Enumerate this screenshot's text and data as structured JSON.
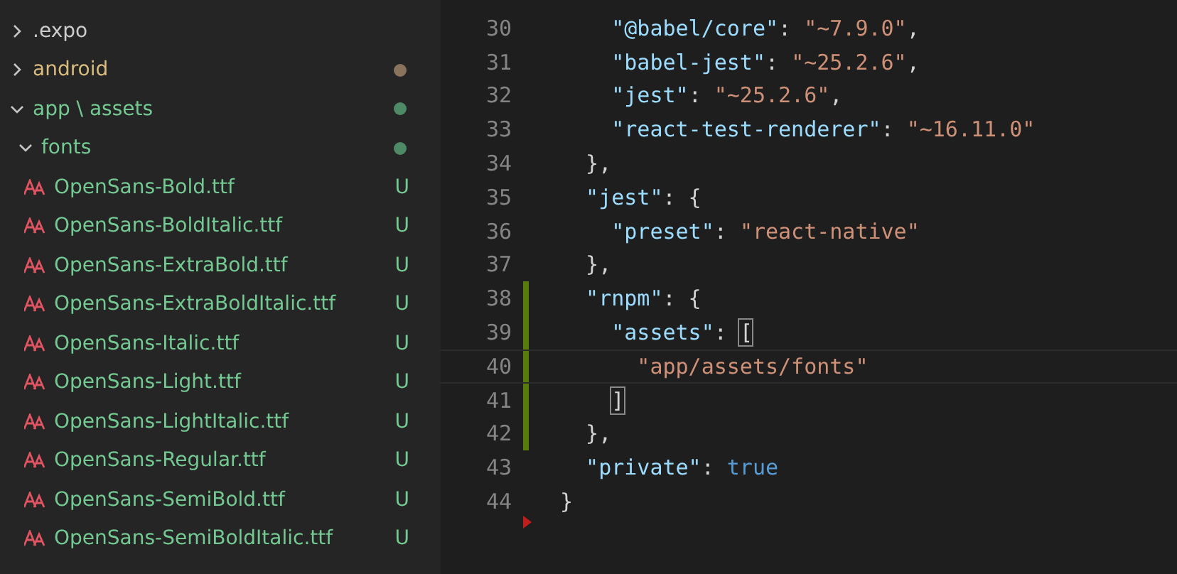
{
  "explorer": {
    "items": [
      {
        "label": ".expo",
        "kind": "folder",
        "expanded": false,
        "color": "#cccccc"
      },
      {
        "label": "android",
        "kind": "folder",
        "expanded": false,
        "color": "#d7ba7d",
        "dot": {
          "color": "#8a735c"
        }
      },
      {
        "label": "app \\ assets",
        "kind": "folder",
        "expanded": true,
        "color": "#73c991",
        "dot": {
          "color": "#4f8a66"
        },
        "children": [
          {
            "label": "fonts",
            "kind": "folder",
            "expanded": true,
            "color": "#73c991",
            "dot": {
              "color": "#4f8a66"
            },
            "children": [
              {
                "label": "OpenSans-Bold.ttf",
                "kind": "file",
                "color": "#73c991",
                "badge": "U"
              },
              {
                "label": "OpenSans-BoldItalic.ttf",
                "kind": "file",
                "color": "#73c991",
                "badge": "U"
              },
              {
                "label": "OpenSans-ExtraBold.ttf",
                "kind": "file",
                "color": "#73c991",
                "badge": "U"
              },
              {
                "label": "OpenSans-ExtraBoldItalic.ttf",
                "kind": "file",
                "color": "#73c991",
                "badge": "U"
              },
              {
                "label": "OpenSans-Italic.ttf",
                "kind": "file",
                "color": "#73c991",
                "badge": "U"
              },
              {
                "label": "OpenSans-Light.ttf",
                "kind": "file",
                "color": "#73c991",
                "badge": "U"
              },
              {
                "label": "OpenSans-LightItalic.ttf",
                "kind": "file",
                "color": "#73c991",
                "badge": "U"
              },
              {
                "label": "OpenSans-Regular.ttf",
                "kind": "file",
                "color": "#73c991",
                "badge": "U"
              },
              {
                "label": "OpenSans-SemiBold.ttf",
                "kind": "file",
                "color": "#73c991",
                "badge": "U"
              },
              {
                "label": "OpenSans-SemiBoldItalic.ttf",
                "kind": "file",
                "color": "#73c991",
                "badge": "U"
              }
            ]
          }
        ]
      }
    ]
  },
  "editor": {
    "lines": [
      {
        "number": "30",
        "modified": false,
        "current": false,
        "tokens": [
          {
            "kind": "key",
            "text": "    \"@babel/core\""
          },
          {
            "kind": "punct",
            "text": ": "
          },
          {
            "kind": "string",
            "text": "\"~7.9.0\""
          },
          {
            "kind": "punct",
            "text": ","
          }
        ]
      },
      {
        "number": "31",
        "modified": false,
        "current": false,
        "tokens": [
          {
            "kind": "key",
            "text": "    \"babel-jest\""
          },
          {
            "kind": "punct",
            "text": ": "
          },
          {
            "kind": "string",
            "text": "\"~25.2.6\""
          },
          {
            "kind": "punct",
            "text": ","
          }
        ]
      },
      {
        "number": "32",
        "modified": false,
        "current": false,
        "tokens": [
          {
            "kind": "key",
            "text": "    \"jest\""
          },
          {
            "kind": "punct",
            "text": ": "
          },
          {
            "kind": "string",
            "text": "\"~25.2.6\""
          },
          {
            "kind": "punct",
            "text": ","
          }
        ]
      },
      {
        "number": "33",
        "modified": false,
        "current": false,
        "tokens": [
          {
            "kind": "key",
            "text": "    \"react-test-renderer\""
          },
          {
            "kind": "punct",
            "text": ": "
          },
          {
            "kind": "string",
            "text": "\"~16.11.0\""
          }
        ]
      },
      {
        "number": "34",
        "modified": false,
        "current": false,
        "tokens": [
          {
            "kind": "punct",
            "text": "  },"
          }
        ]
      },
      {
        "number": "35",
        "modified": false,
        "current": false,
        "tokens": [
          {
            "kind": "key",
            "text": "  \"jest\""
          },
          {
            "kind": "punct",
            "text": ": {"
          }
        ]
      },
      {
        "number": "36",
        "modified": false,
        "current": false,
        "tokens": [
          {
            "kind": "key",
            "text": "    \"preset\""
          },
          {
            "kind": "punct",
            "text": ": "
          },
          {
            "kind": "string",
            "text": "\"react-native\""
          }
        ]
      },
      {
        "number": "37",
        "modified": false,
        "current": false,
        "tokens": [
          {
            "kind": "punct",
            "text": "  },"
          }
        ]
      },
      {
        "number": "38",
        "modified": true,
        "current": false,
        "tokens": [
          {
            "kind": "key",
            "text": "  \"rnpm\""
          },
          {
            "kind": "punct",
            "text": ": {"
          }
        ]
      },
      {
        "number": "39",
        "modified": true,
        "current": false,
        "tokens": [
          {
            "kind": "key",
            "text": "    \"assets\""
          },
          {
            "kind": "punct",
            "text": ": "
          },
          {
            "kind": "bracket",
            "text": "["
          }
        ]
      },
      {
        "number": "40",
        "modified": true,
        "current": true,
        "tokens": [
          {
            "kind": "string",
            "text": "      \"app/assets/fonts\""
          }
        ]
      },
      {
        "number": "41",
        "modified": true,
        "current": false,
        "tokens": [
          {
            "kind": "bracket",
            "text": "    ]"
          }
        ]
      },
      {
        "number": "42",
        "modified": true,
        "current": false,
        "tokens": [
          {
            "kind": "punct",
            "text": "  },"
          }
        ]
      },
      {
        "number": "43",
        "modified": false,
        "current": false,
        "tokens": [
          {
            "kind": "key",
            "text": "  \"private\""
          },
          {
            "kind": "punct",
            "text": ": "
          },
          {
            "kind": "bool",
            "text": "true"
          }
        ]
      },
      {
        "number": "44",
        "modified": false,
        "current": false,
        "deleted_after": true,
        "tokens": [
          {
            "kind": "punct",
            "text": "}"
          }
        ]
      }
    ]
  }
}
